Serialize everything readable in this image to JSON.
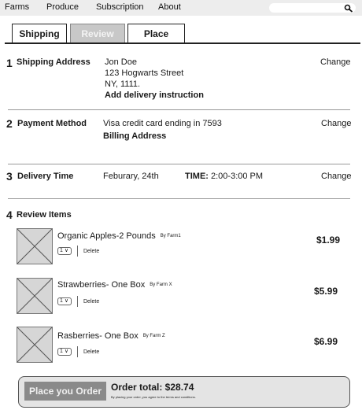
{
  "nav": {
    "items": [
      "Farms",
      "Produce",
      "Subscription",
      "About"
    ],
    "search_icon": "search-icon"
  },
  "tabs": [
    {
      "label": "Shipping",
      "active": false
    },
    {
      "label": "Review",
      "active": true
    },
    {
      "label": "Place",
      "active": false
    }
  ],
  "shipping": {
    "number": "1",
    "title": "Shipping Address",
    "name": "Jon Doe",
    "street": "123 Hogwarts Street",
    "city": "NY, 1111.",
    "instruction": "Add delivery instruction",
    "change": "Change"
  },
  "payment": {
    "number": "2",
    "title": "Payment  Method",
    "card": "Visa credit card ending in  7593",
    "billing": "Billing Address",
    "change": "Change"
  },
  "delivery": {
    "number": "3",
    "title": "Delivery Time",
    "date": "Feburary, 24th",
    "time_label": "TIME:",
    "time": "2:00-3:00 PM",
    "change": "Change"
  },
  "review": {
    "number": "4",
    "title": "Review Items",
    "items": [
      {
        "name": "Organic Apples-2 Pounds",
        "farm": "By Farm1",
        "qty": "1",
        "delete": "Delete",
        "price": "$1.99"
      },
      {
        "name": "Strawberries- One Box",
        "farm": "By Farm X",
        "qty": "1",
        "delete": "Delete",
        "price": "$5.99"
      },
      {
        "name": "Rasberries- One Box",
        "farm": "By Farm Z",
        "qty": "1",
        "delete": "Delete",
        "price": "$6.99"
      }
    ]
  },
  "order": {
    "button": "Place you Order",
    "total": "Order total: $28.74",
    "terms": "By placing your order, you agree to the terms and conditions."
  },
  "colors": {
    "nav_bg": "#ededed",
    "active_tab": "#c8c8c8",
    "button": "#8a8a8a",
    "order_bar": "#e4e4e4"
  }
}
